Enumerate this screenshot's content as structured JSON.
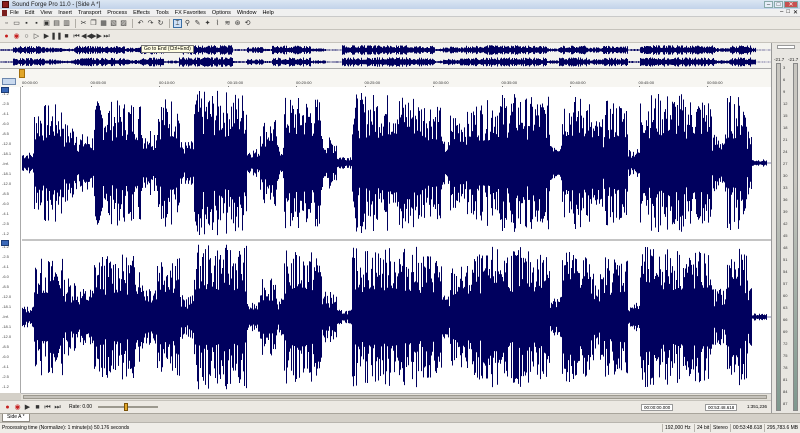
{
  "window": {
    "title": "Sound Forge Pro 11.0 - [Side A *]",
    "minimize": "–",
    "maximize": "□",
    "close": "✕"
  },
  "menu": [
    "File",
    "Edit",
    "View",
    "Insert",
    "Transport",
    "Process",
    "Effects",
    "Tools",
    "FX Favorites",
    "Options",
    "Window",
    "Help"
  ],
  "mdi_controls": [
    "–",
    "□",
    "✕"
  ],
  "tooltip": "Go to End (Ctrl+End)",
  "ruler": {
    "ticks": [
      "00:00:00",
      "00:05:00",
      "00:10:00",
      "00:15:00",
      "00:20:00",
      "00:25:00",
      "00:30:00",
      "00:35:00",
      "00:40:00",
      "00:45:00",
      "00:50:00"
    ]
  },
  "db_scale": {
    "channel1": [
      "-1.2",
      "-2.5",
      "-4.1",
      "-6.0",
      "-8.5",
      "-12.0",
      "-18.1",
      "-Inf.",
      "-18.1",
      "-12.0",
      "-8.5",
      "-6.0",
      "-4.1",
      "-2.5",
      "-1.2"
    ],
    "channel2": [
      "-1.2",
      "-2.5",
      "-4.1",
      "-6.0",
      "-8.5",
      "-12.0",
      "-18.1",
      "-Inf.",
      "-18.1",
      "-12.0",
      "-8.5",
      "-6.0",
      "-4.1",
      "-2.5",
      "-1.2"
    ]
  },
  "transport": {
    "rate_label": "Rate: 0.00",
    "position_start": "00:00:00.000",
    "position_end": "00:53:48.618",
    "zoom": "1:351,236"
  },
  "tabs": [
    "Side A *"
  ],
  "status": {
    "message": "Processing time (Normalize): 1 minute(s) 50.176 seconds",
    "sample_rate": "192,000 Hz",
    "bit_depth": "24 bit",
    "channels": "Stereo",
    "length": "00:53:48.618",
    "size": "295,783.6 MB"
  },
  "meters": {
    "peak_left": "-21.7",
    "peak_right": "-21.7",
    "scale": [
      "3",
      "6",
      "9",
      "12",
      "15",
      "18",
      "21",
      "24",
      "27",
      "30",
      "33",
      "36",
      "39",
      "42",
      "45",
      "48",
      "51",
      "54",
      "57",
      "60",
      "63",
      "66",
      "69",
      "72",
      "75",
      "78",
      "81",
      "84",
      "87"
    ]
  },
  "colors": {
    "waveform": "#00005e",
    "background": "#ffffff",
    "chrome": "#ece9e3"
  }
}
